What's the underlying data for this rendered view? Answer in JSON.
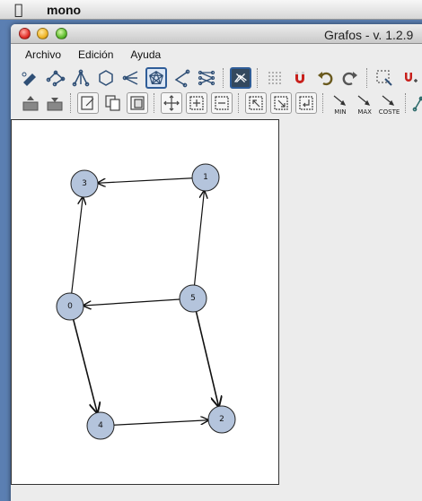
{
  "menubar": {
    "app_name": "mono"
  },
  "window": {
    "title": "Grafos - v. 1.2.9"
  },
  "menu": {
    "items": [
      "Archivo",
      "Edición",
      "Ayuda"
    ]
  },
  "toolbar2": {
    "min_label": "MIN",
    "max_label": "MAX",
    "cost_label": "COSTE"
  },
  "graph": {
    "node_fill": "#b4c4dc",
    "nodes": [
      {
        "id": "0",
        "label": "0"
      },
      {
        "id": "1",
        "label": "1"
      },
      {
        "id": "2",
        "label": "2"
      },
      {
        "id": "3",
        "label": "3"
      },
      {
        "id": "4",
        "label": "4"
      },
      {
        "id": "5",
        "label": "5"
      }
    ],
    "edges": [
      {
        "from": "1",
        "to": "3",
        "directed": true
      },
      {
        "from": "5",
        "to": "1",
        "directed": true
      },
      {
        "from": "5",
        "to": "0",
        "directed": true
      },
      {
        "from": "0",
        "to": "3",
        "directed": true
      },
      {
        "from": "0",
        "to": "4",
        "directed": true
      },
      {
        "from": "5",
        "to": "2",
        "directed": true
      },
      {
        "from": "4",
        "to": "2",
        "directed": true
      }
    ]
  }
}
